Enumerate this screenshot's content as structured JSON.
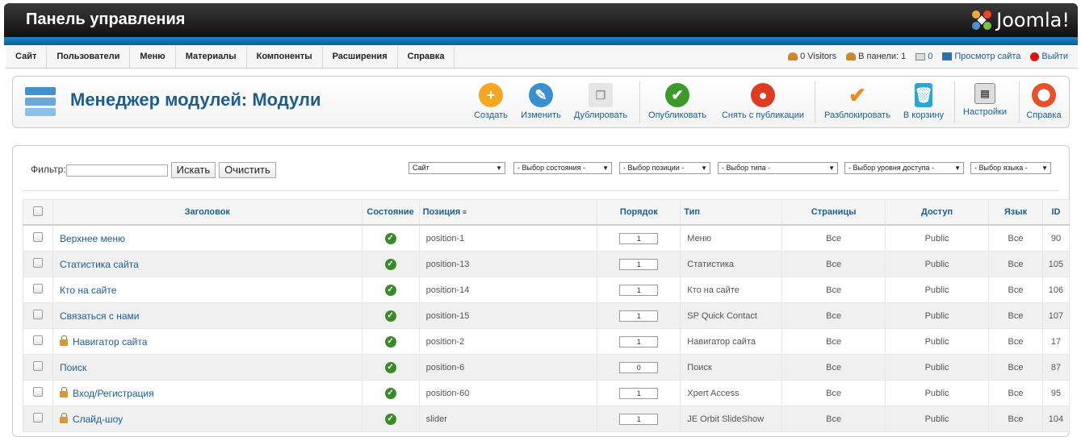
{
  "header": {
    "title": "Панель управления",
    "logo_text": "Joomla!"
  },
  "menu": {
    "items": [
      "Сайт",
      "Пользователи",
      "Меню",
      "Материалы",
      "Компоненты",
      "Расширения",
      "Справка"
    ],
    "status": {
      "visitors": "0 Visitors",
      "admin": "В панели: 1",
      "messages": "0",
      "view_site": "Просмотр сайта",
      "logout": "Выйти"
    }
  },
  "toolbar": {
    "page_title": "Менеджер модулей: Модули",
    "buttons": {
      "new": "Создать",
      "edit": "Изменить",
      "copy": "Дублировать",
      "publish": "Опубликовать",
      "unpublish": "Снять с публикации",
      "checkin": "Разблокировать",
      "trash": "В корзину",
      "options": "Настройки",
      "help": "Справка"
    }
  },
  "filter": {
    "label": "Фильтр:",
    "value": "",
    "search_btn": "Искать",
    "clear_btn": "Очистить",
    "selects": {
      "client": "Сайт",
      "state": "- Выбор состояния -",
      "position": "- Выбор позиции -",
      "type": "- Выбор типа -",
      "access": "- Выбор уровня доступа -",
      "language": "- Выбор языка -"
    }
  },
  "table": {
    "headers": {
      "title": "Заголовок",
      "state": "Состояние",
      "position": "Позиция",
      "ordering": "Порядок",
      "type": "Тип",
      "pages": "Страницы",
      "access": "Доступ",
      "language": "Язык",
      "id": "ID"
    },
    "rows": [
      {
        "title": "Верхнее меню",
        "locked": false,
        "position": "position-1",
        "order": "1",
        "type": "Меню",
        "pages": "Все",
        "access": "Public",
        "lang": "Все",
        "id": "90"
      },
      {
        "title": "Статистика сайта",
        "locked": false,
        "position": "position-13",
        "order": "1",
        "type": "Статистика",
        "pages": "Все",
        "access": "Public",
        "lang": "Все",
        "id": "105"
      },
      {
        "title": "Кто на сайте",
        "locked": false,
        "position": "position-14",
        "order": "1",
        "type": "Кто на сайте",
        "pages": "Все",
        "access": "Public",
        "lang": "Все",
        "id": "106"
      },
      {
        "title": "Связаться с нами",
        "locked": false,
        "position": "position-15",
        "order": "1",
        "type": "SP Quick Contact",
        "pages": "Все",
        "access": "Public",
        "lang": "Все",
        "id": "107"
      },
      {
        "title": "Навигатор сайта",
        "locked": true,
        "position": "position-2",
        "order": "1",
        "type": "Навигатор сайта",
        "pages": "Все",
        "access": "Public",
        "lang": "Все",
        "id": "17"
      },
      {
        "title": "Поиск",
        "locked": false,
        "position": "position-6",
        "order": "0",
        "type": "Поиск",
        "pages": "Все",
        "access": "Public",
        "lang": "Все",
        "id": "87"
      },
      {
        "title": "Вход/Регистрация",
        "locked": true,
        "position": "position-60",
        "order": "1",
        "type": "Xpert Access",
        "pages": "Все",
        "access": "Public",
        "lang": "Все",
        "id": "95"
      },
      {
        "title": "Слайд-шоу",
        "locked": true,
        "position": "slider",
        "order": "1",
        "type": "JE Orbit SlideShow",
        "pages": "Все",
        "access": "Public",
        "lang": "Все",
        "id": "104"
      }
    ]
  }
}
